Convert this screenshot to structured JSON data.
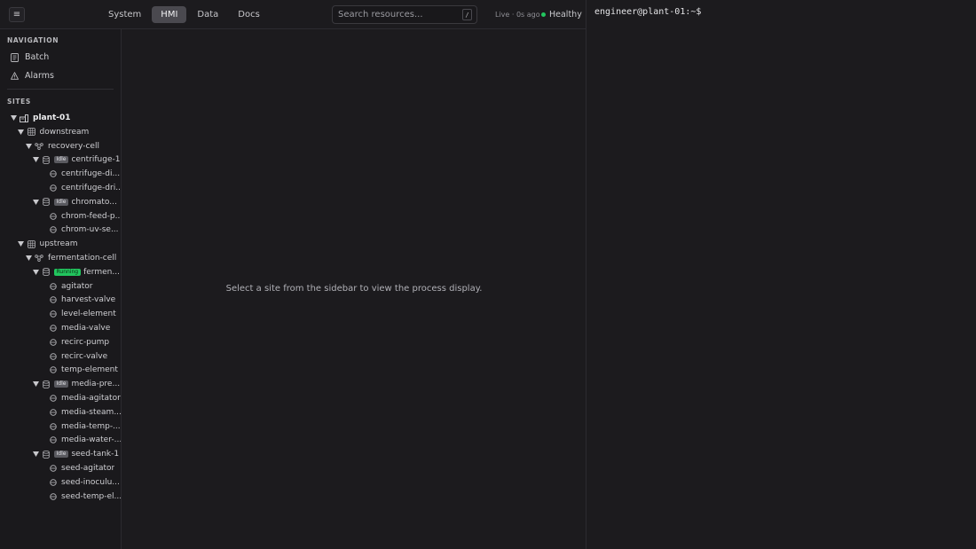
{
  "header": {
    "menu_glyph": "≡",
    "tabs": [
      {
        "label": "System",
        "active": false
      },
      {
        "label": "HMI",
        "active": true
      },
      {
        "label": "Data",
        "active": false
      },
      {
        "label": "Docs",
        "active": false
      }
    ],
    "search": {
      "placeholder": "Search resources...",
      "shortcut": "/"
    },
    "live_status": "Live · 0s ago",
    "health": {
      "label": "Healthy",
      "color": "#22c55e"
    }
  },
  "sidebar": {
    "navigation_title": "NAVIGATION",
    "nav_items": [
      {
        "label": "Batch",
        "icon": "document-icon"
      },
      {
        "label": "Alarms",
        "icon": "warning-icon"
      }
    ],
    "sites_title": "SITES",
    "tree": [
      {
        "label": "plant-01",
        "kind": "site",
        "expanded": true,
        "badge": ""
      },
      {
        "label": "downstream",
        "kind": "area",
        "expanded": true,
        "badge": ""
      },
      {
        "label": "recovery-cell",
        "kind": "cell",
        "expanded": true,
        "badge": ""
      },
      {
        "label": "centrifuge-1",
        "kind": "unit",
        "expanded": true,
        "badge": "Idle"
      },
      {
        "label": "centrifuge-di...",
        "kind": "module",
        "badge": ""
      },
      {
        "label": "centrifuge-dri...",
        "kind": "module",
        "badge": ""
      },
      {
        "label": "chromato...",
        "kind": "unit",
        "expanded": true,
        "badge": "Idle"
      },
      {
        "label": "chrom-feed-p...",
        "kind": "module",
        "badge": ""
      },
      {
        "label": "chrom-uv-se...",
        "kind": "module",
        "badge": ""
      },
      {
        "label": "upstream",
        "kind": "area",
        "expanded": true,
        "badge": ""
      },
      {
        "label": "fermentation-cell",
        "kind": "cell",
        "expanded": true,
        "badge": ""
      },
      {
        "label": "fermen...",
        "kind": "unit",
        "expanded": true,
        "badge": "Running"
      },
      {
        "label": "agitator",
        "kind": "module",
        "badge": ""
      },
      {
        "label": "harvest-valve",
        "kind": "module",
        "badge": ""
      },
      {
        "label": "level-element",
        "kind": "module",
        "badge": ""
      },
      {
        "label": "media-valve",
        "kind": "module",
        "badge": ""
      },
      {
        "label": "recirc-pump",
        "kind": "module",
        "badge": ""
      },
      {
        "label": "recirc-valve",
        "kind": "module",
        "badge": ""
      },
      {
        "label": "temp-element",
        "kind": "module",
        "badge": ""
      },
      {
        "label": "media-pre...",
        "kind": "unit",
        "expanded": true,
        "badge": "Idle"
      },
      {
        "label": "media-agitator",
        "kind": "module",
        "badge": ""
      },
      {
        "label": "media-steam...",
        "kind": "module",
        "badge": ""
      },
      {
        "label": "media-temp-...",
        "kind": "module",
        "badge": ""
      },
      {
        "label": "media-water-...",
        "kind": "module",
        "badge": ""
      },
      {
        "label": "seed-tank-1",
        "kind": "unit",
        "expanded": true,
        "badge": "Idle"
      },
      {
        "label": "seed-agitator",
        "kind": "module",
        "badge": ""
      },
      {
        "label": "seed-inoculu...",
        "kind": "module",
        "badge": ""
      },
      {
        "label": "seed-temp-el...",
        "kind": "module",
        "badge": ""
      }
    ],
    "badge_colors": {
      "Idle": "#5a5a60",
      "Running": "#22c55e"
    }
  },
  "main": {
    "empty_message": "Select a site from the sidebar to view the process display."
  },
  "terminal": {
    "prompt": "engineer@plant-01:~$"
  }
}
